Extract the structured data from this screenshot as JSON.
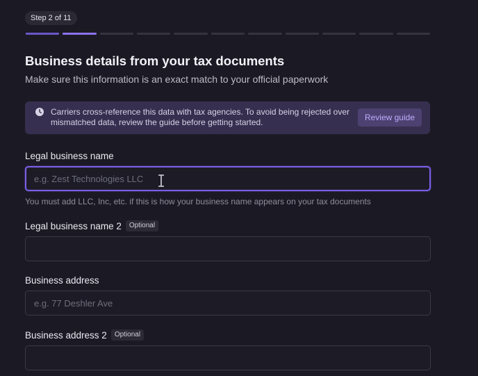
{
  "stepper": {
    "label": "Step 2 of 11",
    "total_steps": 11,
    "current_step": 2
  },
  "header": {
    "title": "Business details from your tax documents",
    "subtitle": "Make sure this information is an exact match to your official paperwork"
  },
  "notice": {
    "icon": "clock-icon",
    "text": "Carriers cross-reference this data with tax agencies. To avoid being rejected over mismatched data, review the guide before getting started.",
    "button_label": "Review guide"
  },
  "form": {
    "legal_name": {
      "label": "Legal business name",
      "placeholder": "e.g. Zest Technologies LLC",
      "value": "",
      "hint": "You must add LLC, Inc, etc. if this is how your business name appears on your tax documents"
    },
    "legal_name_2": {
      "label": "Legal business name 2",
      "badge": "Optional",
      "placeholder": "",
      "value": ""
    },
    "address": {
      "label": "Business address",
      "placeholder": "e.g. 77 Deshler Ave",
      "value": ""
    },
    "address_2": {
      "label": "Business address 2",
      "badge": "Optional",
      "placeholder": "",
      "value": ""
    }
  },
  "colors": {
    "background": "#1b1a24",
    "accent": "#8b72f0",
    "notice_bg": "#372f4f",
    "button_text": "#bfaeff"
  }
}
